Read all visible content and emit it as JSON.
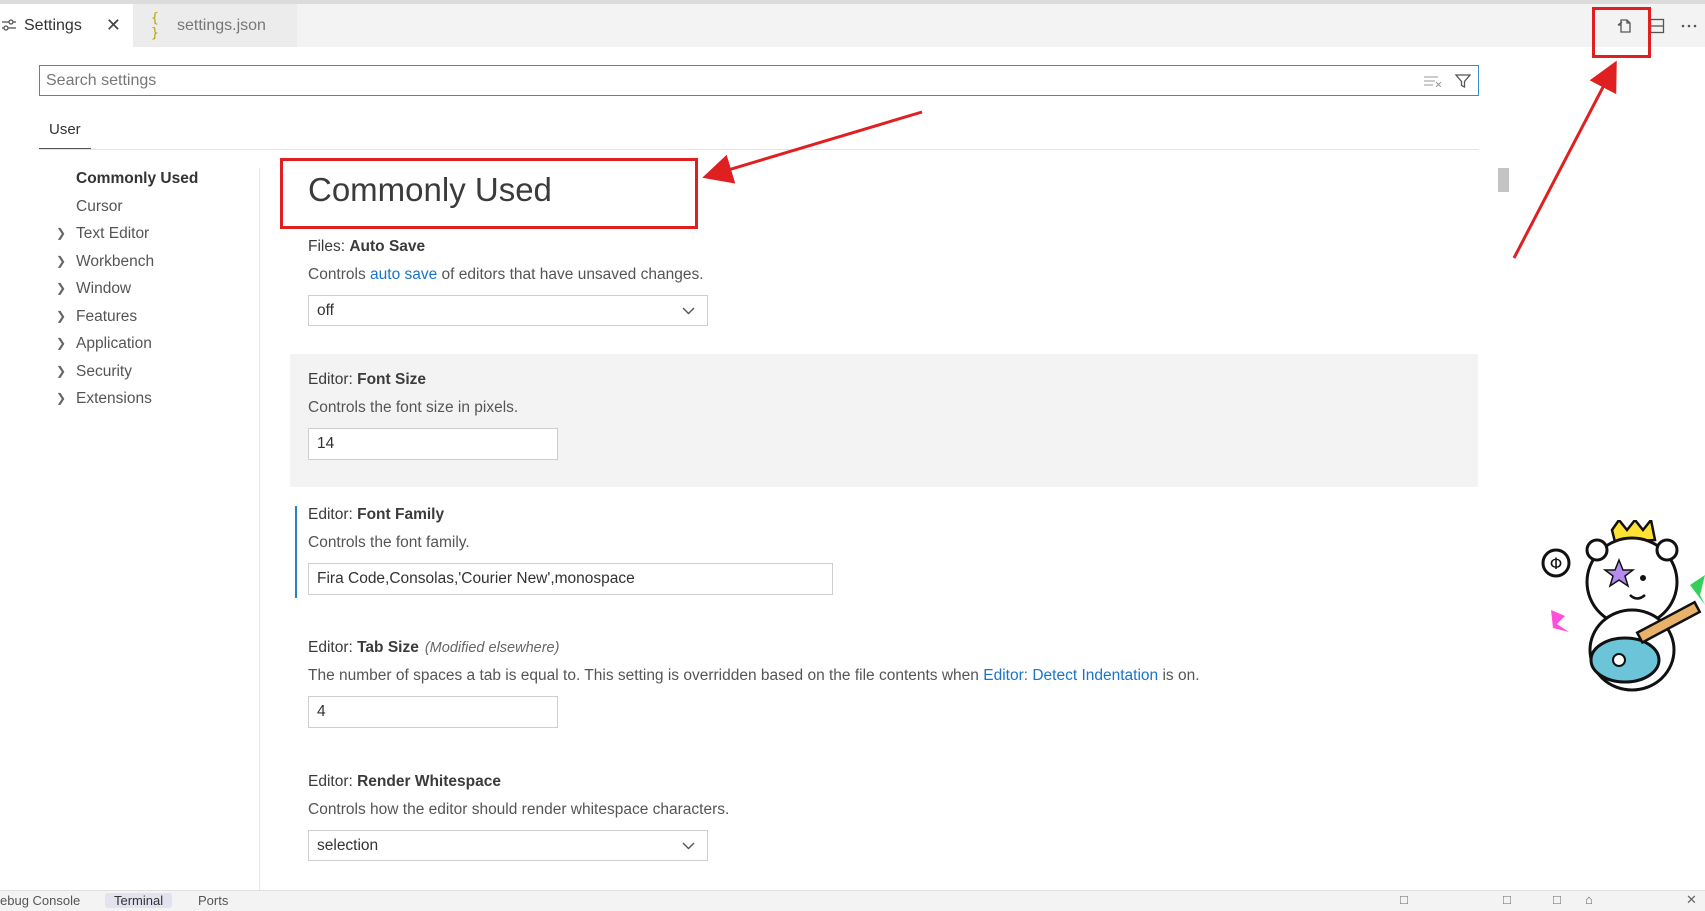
{
  "tabs": [
    {
      "label": "Settings",
      "icon": "settings-sliders-icon",
      "active": true
    },
    {
      "label": "settings.json",
      "icon": "json-braces-icon",
      "active": false
    }
  ],
  "tab_close_glyph": "✕",
  "json_icon_glyph": "{ }",
  "editor_actions": [
    "open-settings-json-icon",
    "split-editor-icon",
    "more-actions-icon"
  ],
  "search": {
    "placeholder": "Search settings",
    "value": ""
  },
  "scope_tabs": [
    {
      "label": "User"
    }
  ],
  "toc": [
    {
      "label": "Commonly Used",
      "active": true,
      "expandable": false
    },
    {
      "label": "Cursor",
      "active": false,
      "expandable": false
    },
    {
      "label": "Text Editor",
      "active": false,
      "expandable": true
    },
    {
      "label": "Workbench",
      "active": false,
      "expandable": true
    },
    {
      "label": "Window",
      "active": false,
      "expandable": true
    },
    {
      "label": "Features",
      "active": false,
      "expandable": true
    },
    {
      "label": "Application",
      "active": false,
      "expandable": true
    },
    {
      "label": "Security",
      "active": false,
      "expandable": true
    },
    {
      "label": "Extensions",
      "active": false,
      "expandable": true
    }
  ],
  "section_heading": "Commonly Used",
  "settings": {
    "auto_save": {
      "category": "Files: ",
      "name": "Auto Save",
      "desc_pre": "Controls ",
      "desc_link": "auto save",
      "desc_post": " of editors that have unsaved changes.",
      "value": "off"
    },
    "font_size": {
      "category": "Editor: ",
      "name": "Font Size",
      "desc": "Controls the font size in pixels.",
      "value": "14"
    },
    "font_family": {
      "category": "Editor: ",
      "name": "Font Family",
      "desc": "Controls the font family.",
      "value": "Fira Code,Consolas,'Courier New',monospace"
    },
    "tab_size": {
      "category": "Editor: ",
      "name": "Tab Size",
      "modified": "(Modified elsewhere)",
      "desc_pre": "The number of spaces a tab is equal to. This setting is overridden based on the file contents when ",
      "desc_link": "Editor: Detect Indentation",
      "desc_post": " is on.",
      "value": "4"
    },
    "render_whitespace": {
      "category": "Editor: ",
      "name": "Render Whitespace",
      "desc": "Controls how the editor should render whitespace characters.",
      "value": "selection"
    }
  },
  "panel": {
    "tabs": [
      "ebug Console",
      "Terminal",
      "Ports"
    ],
    "active": "Terminal"
  },
  "colors": {
    "annotation": "#e02020",
    "accent": "#1a74c9",
    "focus_border": "#3a8ad6"
  }
}
